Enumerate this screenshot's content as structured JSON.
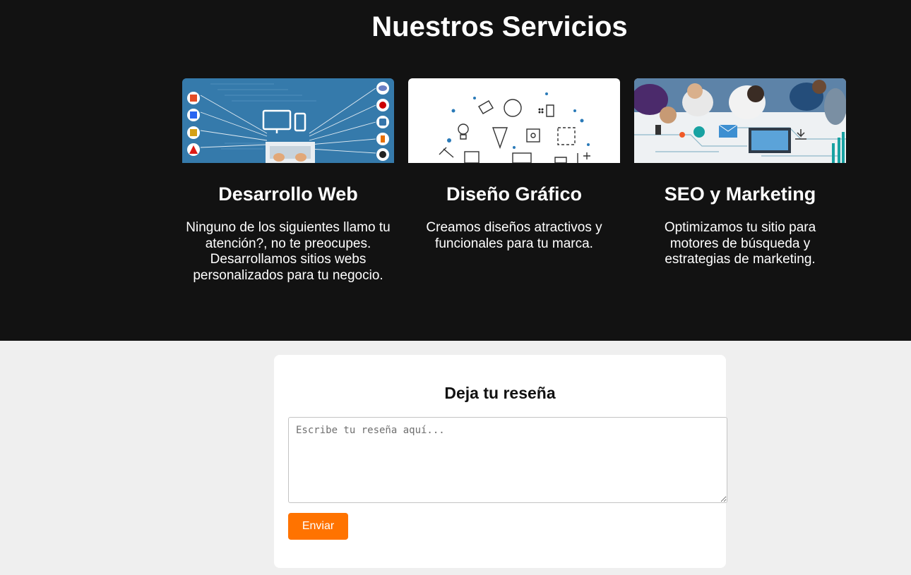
{
  "services": {
    "title": "Nuestros Servicios",
    "cards": [
      {
        "image_icon": "web-development-image",
        "title": "Desarrollo Web",
        "text": "Ninguno de los siguientes llamo tu atención?, no te preocupes. Desarrollamos sitios webs personalizados para tu negocio."
      },
      {
        "image_icon": "graphic-design-image",
        "title": "Diseño Gráfico",
        "text": "Creamos diseños atractivos y funcionales para tu marca."
      },
      {
        "image_icon": "seo-marketing-image",
        "title": "SEO y Marketing",
        "text": "Optimizamos tu sitio para motores de búsqueda y estrategias de marketing."
      }
    ]
  },
  "review": {
    "title": "Deja tu reseña",
    "placeholder": "Escribe tu reseña aquí...",
    "value": "",
    "submit_label": "Enviar"
  },
  "colors": {
    "services_bg": "#121212",
    "page_bg": "#efefef",
    "accent": "#ff7300"
  }
}
